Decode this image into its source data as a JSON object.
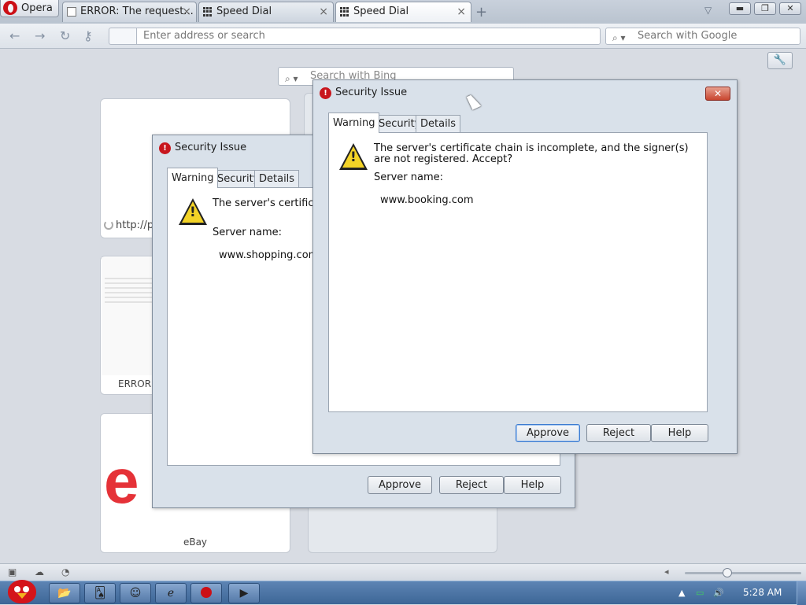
{
  "browser": {
    "menu_label": "Opera",
    "tabs": [
      {
        "label": "ERROR: The request...",
        "icon": "page-icon",
        "active": false
      },
      {
        "label": "Speed Dial",
        "icon": "speed-dial-grid-icon",
        "active": false
      },
      {
        "label": "Speed Dial",
        "icon": "speed-dial-grid-icon",
        "active": true
      }
    ],
    "address_placeholder": "Enter address or search",
    "search_placeholder": "Search with Google"
  },
  "speed_dial": {
    "search_placeholder": "Search with Bing",
    "tiles": [
      {
        "label": "http://p",
        "loading": true
      },
      {
        "label": "ERROR",
        "thumb_title": "ERROR",
        "thumb_subtitle": "The requested"
      },
      {
        "label": "eBay",
        "logo_text": "e"
      }
    ]
  },
  "dialog_back": {
    "title": "Security Issue",
    "tabs": [
      "Warning",
      "Security",
      "Details"
    ],
    "message": "The server's certificate registered. Accept?",
    "server_label": "Server name:",
    "server_name": "www.shopping.com",
    "buttons": {
      "approve": "Approve",
      "reject": "Reject",
      "help": "Help"
    }
  },
  "dialog_front": {
    "title": "Security Issue",
    "tabs": [
      "Warning",
      "Security",
      "Details"
    ],
    "message": "The server's certificate chain is incomplete, and the signer(s) are not registered. Accept?",
    "server_label": "Server name:",
    "server_name": "www.booking.com",
    "buttons": {
      "approve": "Approve",
      "reject": "Reject",
      "help": "Help"
    }
  },
  "taskbar": {
    "clock": "5:28 AM"
  },
  "colors": {
    "opera_red": "#cc0f16",
    "ebay_red": "#e53238",
    "taskbar_blue": "#3d6697",
    "dialog_frame": "#d9e1ea"
  }
}
